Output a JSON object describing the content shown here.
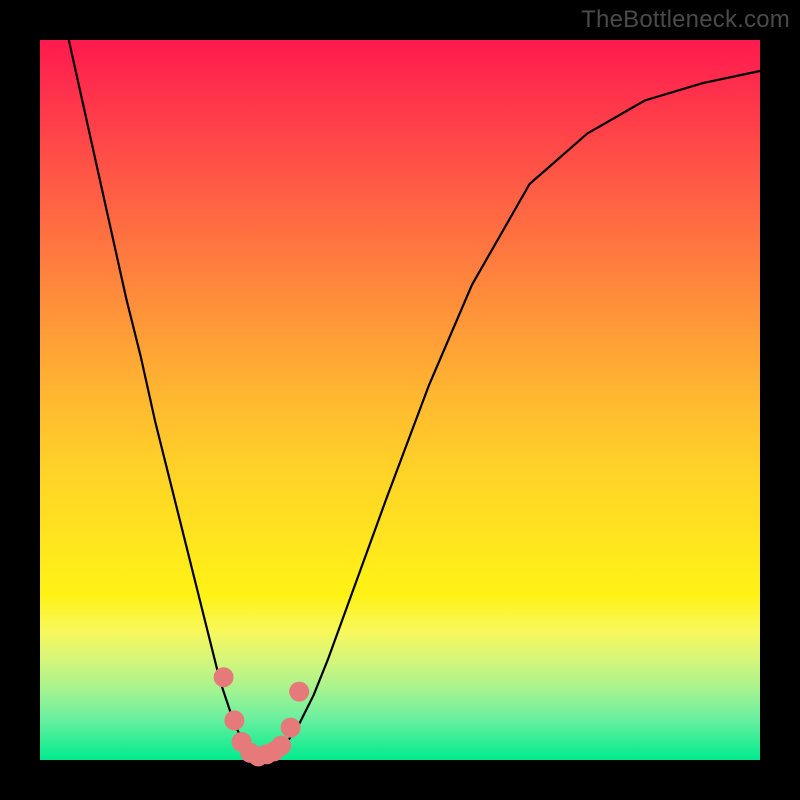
{
  "watermark": "TheBottleneck.com",
  "chart_data": {
    "type": "line",
    "title": "",
    "xlabel": "",
    "ylabel": "",
    "xlim": [
      0,
      1
    ],
    "ylim": [
      0,
      1
    ],
    "legend": false,
    "grid": false,
    "background": "rainbow-gradient red→green (top→bottom)",
    "series": [
      {
        "name": "curve",
        "color": "#000000",
        "x": [
          0.04,
          0.06,
          0.08,
          0.1,
          0.12,
          0.14,
          0.16,
          0.18,
          0.2,
          0.22,
          0.24,
          0.25,
          0.26,
          0.27,
          0.28,
          0.29,
          0.3,
          0.31,
          0.32,
          0.33,
          0.34,
          0.36,
          0.38,
          0.4,
          0.44,
          0.48,
          0.54,
          0.6,
          0.68,
          0.76,
          0.84,
          0.92,
          1.0
        ],
        "y": [
          1.0,
          0.91,
          0.82,
          0.73,
          0.64,
          0.56,
          0.47,
          0.39,
          0.31,
          0.23,
          0.15,
          0.11,
          0.08,
          0.05,
          0.03,
          0.015,
          0.01,
          0.005,
          0.005,
          0.01,
          0.02,
          0.05,
          0.09,
          0.14,
          0.25,
          0.36,
          0.52,
          0.66,
          0.8,
          0.87,
          0.916,
          0.94,
          0.957
        ]
      },
      {
        "name": "sample-points",
        "color": "#e67a7a",
        "marker": "circle",
        "x": [
          0.255,
          0.27,
          0.28,
          0.292,
          0.303,
          0.315,
          0.325,
          0.335,
          0.348,
          0.36
        ],
        "y": [
          0.115,
          0.055,
          0.025,
          0.01,
          0.005,
          0.008,
          0.012,
          0.02,
          0.045,
          0.095
        ]
      }
    ]
  }
}
